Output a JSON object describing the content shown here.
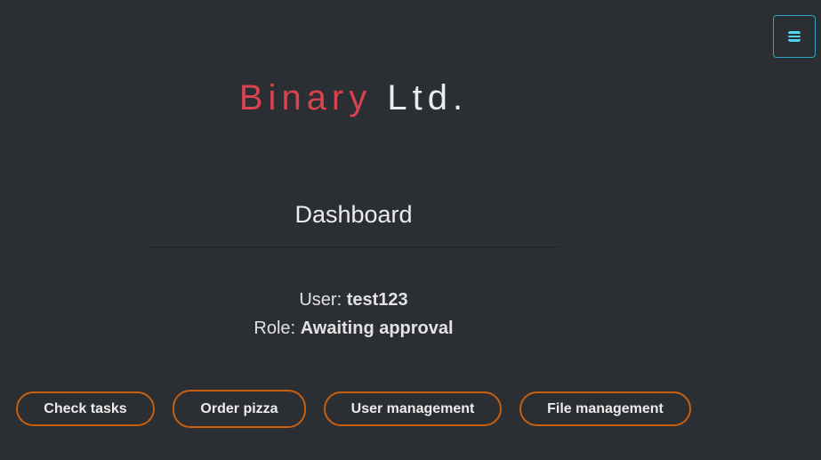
{
  "header": {
    "brand_primary": "Binary",
    "brand_secondary": "Ltd.",
    "menu_icon": "hamburger-icon"
  },
  "main": {
    "title": "Dashboard",
    "user_label": "User:",
    "user_value": "test123",
    "role_label": "Role:",
    "role_value": "Awaiting approval"
  },
  "actions": {
    "check_tasks": "Check tasks",
    "order_pizza": "Order pizza",
    "user_management": "User management",
    "file_management": "File management"
  },
  "colors": {
    "background": "#2b2e33",
    "brand_accent": "#d9434f",
    "button_border": "#c8600f",
    "menu_accent": "#4fd3f0"
  }
}
